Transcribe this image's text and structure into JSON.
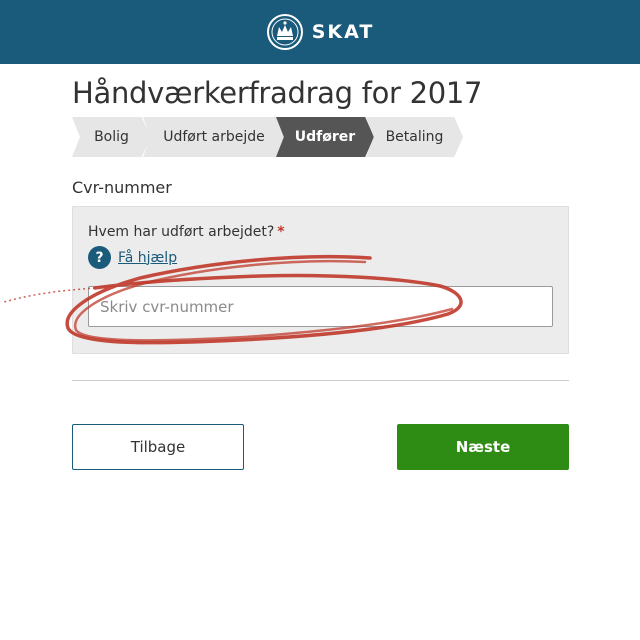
{
  "header": {
    "brand_name": "SKAT",
    "logo_icon": "crown-emblem-icon",
    "background_color": "#1a5a7a"
  },
  "page": {
    "title": "Håndværkerfradrag for 2017"
  },
  "steps": [
    {
      "label": "Bolig",
      "active": false
    },
    {
      "label": "Udført arbejde",
      "active": false
    },
    {
      "label": "Udfører",
      "active": true
    },
    {
      "label": "Betaling",
      "active": false
    }
  ],
  "form": {
    "section_label": "Cvr-nummer",
    "question": "Hvem har udført arbejdet?",
    "required_mark": "*",
    "help_icon": "question-mark-icon",
    "help_icon_glyph": "?",
    "help_link": "Få hjælp",
    "cvr_input": {
      "value": "",
      "placeholder": "Skriv cvr-nummer"
    }
  },
  "buttons": {
    "back_label": "Tilbage",
    "next_label": "Næste"
  },
  "colors": {
    "primary": "#1a5a7a",
    "active_step": "#555555",
    "inactive_step": "#e6e6e6",
    "next_button": "#2e8b14",
    "required": "#c0392b",
    "annotation": "#c0392b"
  },
  "annotation": {
    "type": "hand-drawn-circle-around-input"
  }
}
